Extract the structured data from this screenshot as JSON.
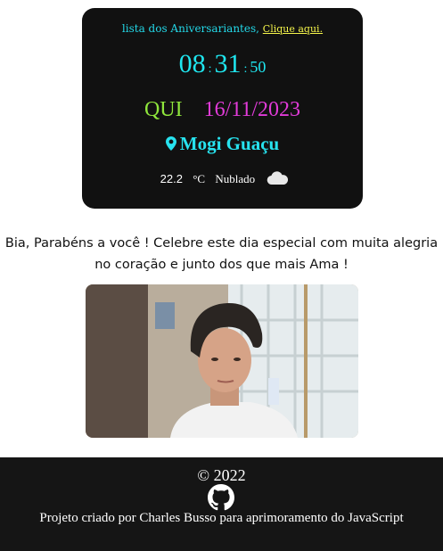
{
  "header": {
    "aniversariantes_text": "lista dos Aniversariantes,",
    "link_text": "Clique aqui."
  },
  "clock": {
    "hours": "08",
    "separator": ":",
    "minutes": "31",
    "seconds": "50"
  },
  "date": {
    "day_of_week": "QUI",
    "date": "16/11/2023"
  },
  "location": {
    "city": "Mogi Guaçu"
  },
  "weather": {
    "temperature": "22.2",
    "unit": "°C",
    "condition": "Nublado",
    "icon": "cloud-icon"
  },
  "message": {
    "line1": "Bia, Parabéns a você ! Celebre este dia especial com muita alegria",
    "line2": "no coração e junto dos que mais Ama !"
  },
  "footer": {
    "copyright": "© 2022",
    "credit": "Projeto criado por Charles Busso para aprimoramento do JavaScript",
    "icon": "github-icon"
  },
  "colors": {
    "card_bg": "#111111",
    "clock": "#1fe6ef",
    "day_of_week": "#8fe63c",
    "date": "#e23bd9",
    "city": "#27e2ee",
    "link": "#f3f34a",
    "footer_bg": "#151515"
  }
}
